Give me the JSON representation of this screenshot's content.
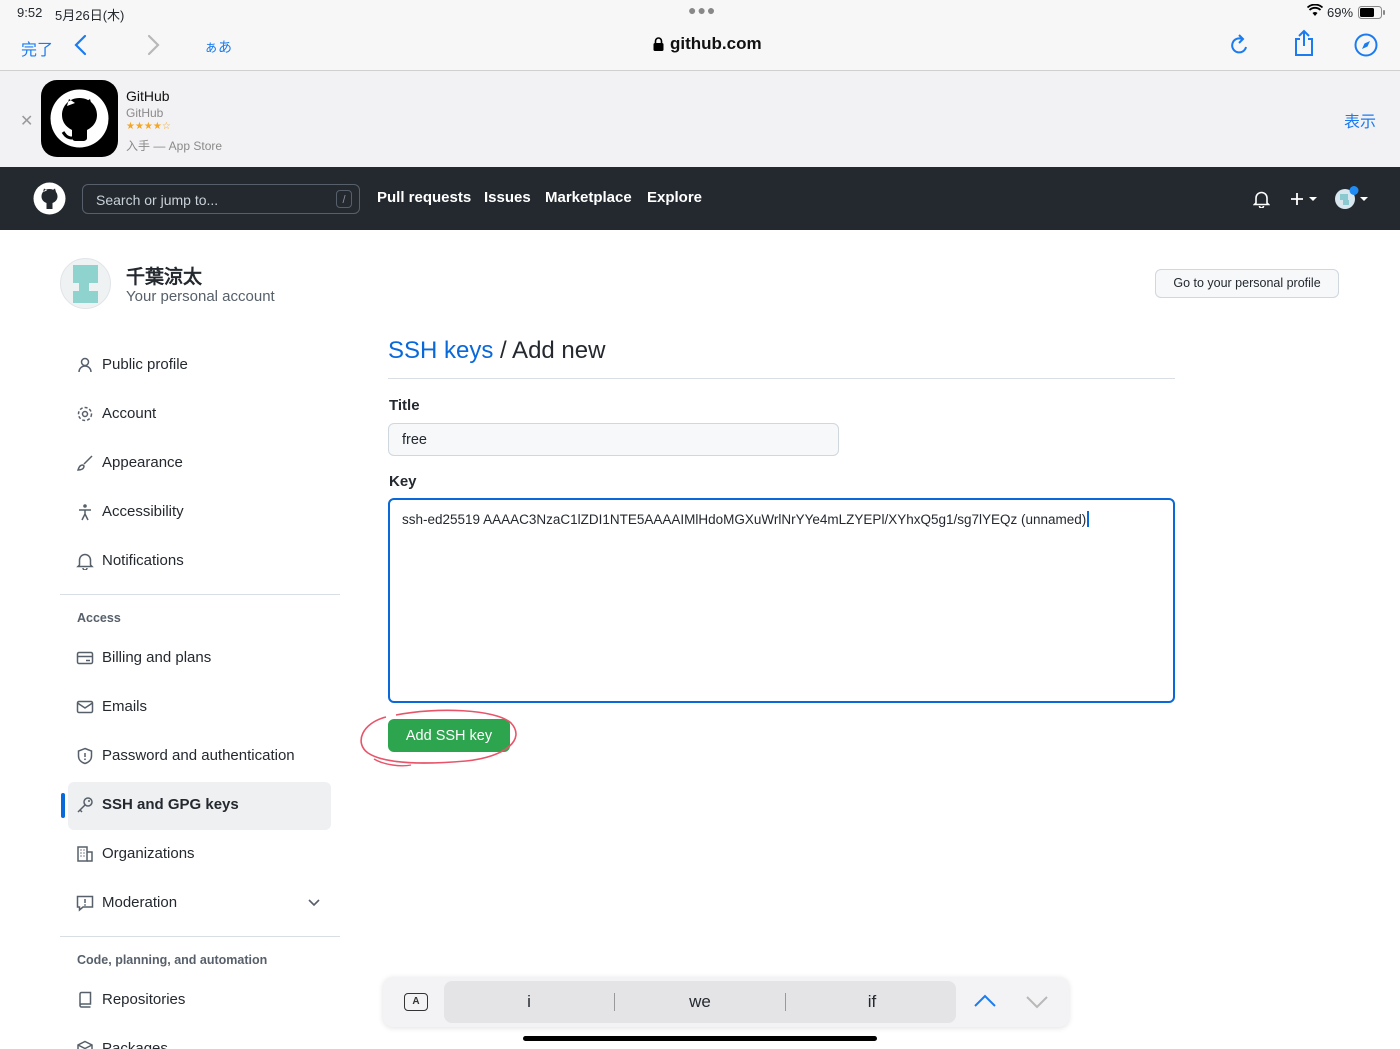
{
  "status": {
    "time": "9:52",
    "date": "5月26日(木)",
    "battery": "69%"
  },
  "safari": {
    "done": "完了",
    "reader": "ぁあ",
    "url": "github.com"
  },
  "app_banner": {
    "name": "GitHub",
    "publisher": "GitHub",
    "stars": "★★★★☆",
    "store": "入手 — App Store",
    "action": "表示"
  },
  "header": {
    "search_placeholder": "Search or jump to...",
    "search_key": "/",
    "nav": [
      "Pull requests",
      "Issues",
      "Marketplace",
      "Explore"
    ]
  },
  "account": {
    "name": "千葉涼太",
    "subtitle": "Your personal account",
    "profile_button": "Go to your personal profile"
  },
  "sidebar": {
    "items": [
      {
        "label": "Public profile",
        "icon": "person-icon"
      },
      {
        "label": "Account",
        "icon": "gear-icon"
      },
      {
        "label": "Appearance",
        "icon": "paintbrush-icon"
      },
      {
        "label": "Accessibility",
        "icon": "accessibility-icon"
      },
      {
        "label": "Notifications",
        "icon": "bell-icon"
      }
    ],
    "access_heading": "Access",
    "access_items": [
      {
        "label": "Billing and plans",
        "icon": "credit-card-icon"
      },
      {
        "label": "Emails",
        "icon": "mail-icon"
      },
      {
        "label": "Password and authentication",
        "icon": "shield-icon"
      },
      {
        "label": "SSH and GPG keys",
        "icon": "key-icon",
        "selected": true
      },
      {
        "label": "Organizations",
        "icon": "organization-icon"
      },
      {
        "label": "Moderation",
        "icon": "report-icon"
      }
    ],
    "code_heading": "Code, planning, and automation",
    "code_items": [
      {
        "label": "Repositories",
        "icon": "repo-icon"
      },
      {
        "label": "Packages",
        "icon": "package-icon"
      }
    ]
  },
  "main": {
    "breadcrumb_link": "SSH keys",
    "breadcrumb_rest": " / Add new",
    "title_label": "Title",
    "title_value": "free",
    "key_label": "Key",
    "key_value": "ssh-ed25519 AAAAC3NzaC1lZDI1NTE5AAAAIMlHdoMGXuWrlNrYYe4mLZYEPl/XYhxQ5g1/sg7lYEQz (unnamed)",
    "submit": "Add SSH key"
  },
  "keyboard": {
    "suggestions": [
      "i",
      "we",
      "if"
    ]
  },
  "colors": {
    "accent": "#0969da",
    "green": "#2da44e",
    "header": "#24292f",
    "annotation": "#e8556a"
  }
}
